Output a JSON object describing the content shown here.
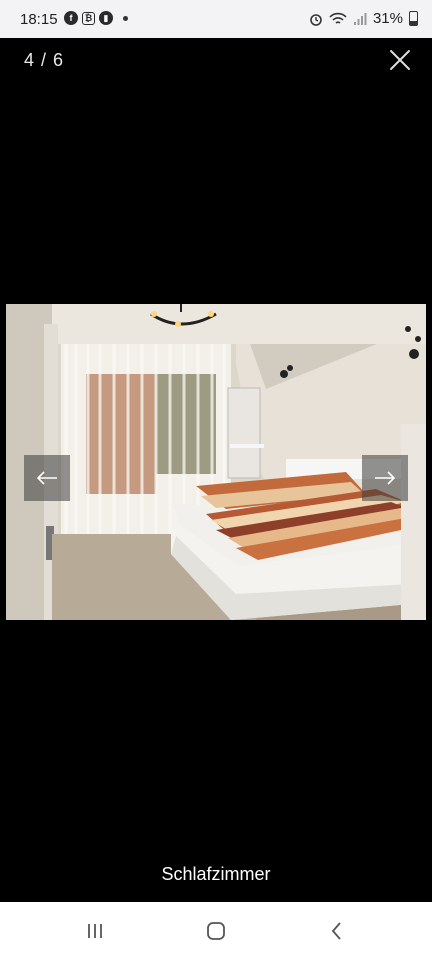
{
  "status_bar": {
    "time": "18:15",
    "left_icons": [
      "facebook-icon",
      "bitcoin-app-icon",
      "app-icon"
    ],
    "battery": "31%",
    "right_icons": [
      "alarm-icon",
      "wifi-icon",
      "signal-icon",
      "battery-icon"
    ]
  },
  "viewer": {
    "counter": "4 / 6",
    "caption": "Schlafzimmer",
    "photo_subject": "bedroom"
  },
  "nav_bar": {
    "buttons": [
      "recent-apps",
      "home",
      "back"
    ]
  }
}
